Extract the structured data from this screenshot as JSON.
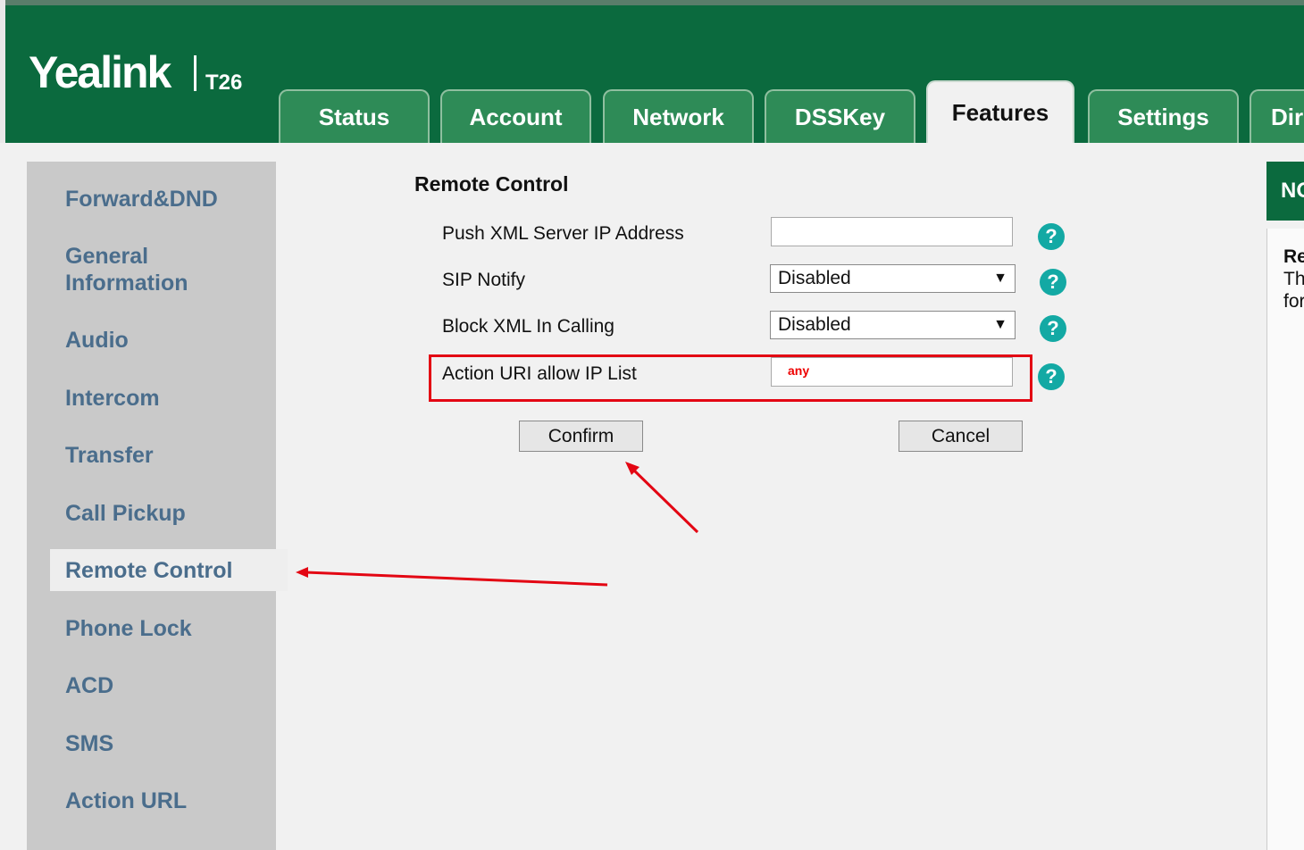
{
  "logo": {
    "brand": "Yealink",
    "model": "T26"
  },
  "tabs": [
    {
      "label": "Status"
    },
    {
      "label": "Account"
    },
    {
      "label": "Network"
    },
    {
      "label": "DSSKey"
    },
    {
      "label": "Features",
      "active": true
    },
    {
      "label": "Settings"
    },
    {
      "label": "Dir"
    }
  ],
  "sidebar": {
    "items": [
      {
        "label": "Forward&DND"
      },
      {
        "label": "General Information"
      },
      {
        "label": "Audio"
      },
      {
        "label": "Intercom"
      },
      {
        "label": "Transfer"
      },
      {
        "label": "Call Pickup"
      },
      {
        "label": "Remote Control",
        "active": true
      },
      {
        "label": "Phone Lock"
      },
      {
        "label": "ACD"
      },
      {
        "label": "SMS"
      },
      {
        "label": "Action URL"
      }
    ]
  },
  "main": {
    "title": "Remote Control",
    "fields": {
      "push_xml": {
        "label": "Push XML Server IP Address",
        "value": ""
      },
      "sip_notify": {
        "label": "SIP Notify",
        "value": "Disabled"
      },
      "block_xml": {
        "label": "Block XML In Calling",
        "value": "Disabled"
      },
      "action_uri": {
        "label": "Action URI allow IP List",
        "value": "any"
      }
    },
    "confirm_label": "Confirm",
    "cancel_label": "Cancel"
  },
  "help_icon_glyph": "?",
  "select_arrow_glyph": "▼",
  "right_panel": {
    "heading": "NO",
    "lines": [
      "Re",
      "Th",
      "for"
    ]
  },
  "colors": {
    "header": "#0b6a3e",
    "tab": "#2e8b57",
    "sidebar_link": "#4a6d8c",
    "help": "#13a9a4",
    "annotation": "#e30613"
  }
}
